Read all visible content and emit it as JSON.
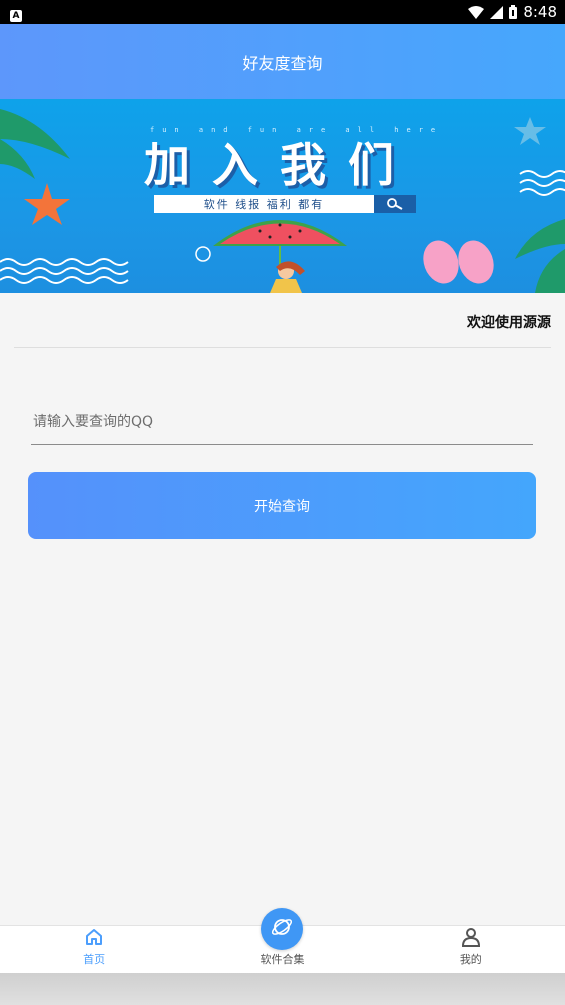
{
  "status_bar": {
    "badge": "A",
    "time": "8:48",
    "icons": [
      "wifi-icon",
      "signal-icon",
      "battery-icon"
    ]
  },
  "header": {
    "title": "好友度查询"
  },
  "banner": {
    "tagline": "fun and fun are all here",
    "title": "加入我们",
    "search_text": "软件 线报 福利 都有"
  },
  "welcome_text": "欢迎使用源源",
  "form": {
    "qq_placeholder": "请输入要查询的QQ",
    "qq_value": "",
    "submit_label": "开始查询"
  },
  "tab_bar": {
    "items": [
      {
        "label": "首页",
        "icon": "home-icon",
        "active": true
      },
      {
        "label": "软件合集",
        "icon": "planet-icon",
        "active": false
      },
      {
        "label": "我的",
        "icon": "user-icon",
        "active": false
      }
    ]
  },
  "colors": {
    "accent": "#4c9efc",
    "header_start": "#5d97fb",
    "header_end": "#46a7fc",
    "banner_blue": "#0ea2ea"
  }
}
